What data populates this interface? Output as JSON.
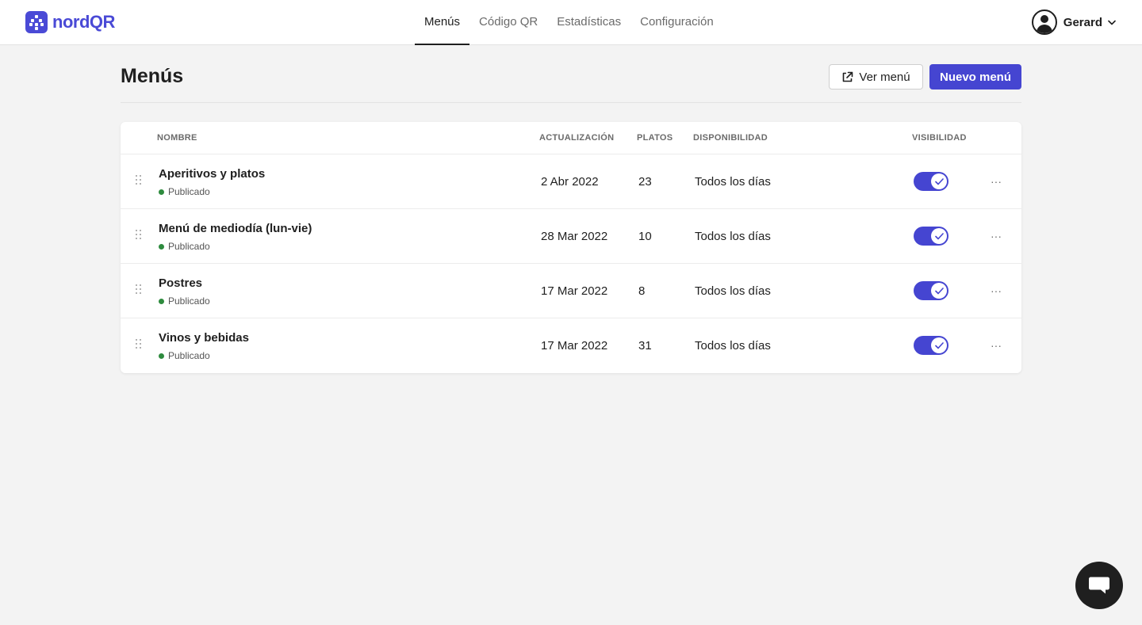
{
  "brand": {
    "name": "nordQR",
    "color": "#4a4ad6"
  },
  "nav": [
    {
      "label": "Menús",
      "active": true
    },
    {
      "label": "Código QR",
      "active": false
    },
    {
      "label": "Estadísticas",
      "active": false
    },
    {
      "label": "Configuración",
      "active": false
    }
  ],
  "user": {
    "name": "Gerard",
    "avatar_icon": "user-avatar-icon",
    "menu_icon": "chevron-down-icon"
  },
  "page": {
    "title": "Menús",
    "view_button": "Ver menú",
    "view_button_icon": "external-link-icon",
    "new_button": "Nuevo menú",
    "accent": "#4545d1"
  },
  "table": {
    "columns": {
      "name": "NOMBRE",
      "updated": "ACTUALIZACIÓN",
      "dishes": "PLATOS",
      "availability": "DISPONIBILIDAD",
      "visibility": "VISIBILIDAD"
    },
    "rows": [
      {
        "name": "Aperitivos y platos",
        "status": "Publicado",
        "updated": "2 Abr 2022",
        "dishes": "23",
        "availability": "Todos los días",
        "visible": true
      },
      {
        "name": "Menú de mediodía (lun-vie)",
        "status": "Publicado",
        "updated": "28 Mar 2022",
        "dishes": "10",
        "availability": "Todos los días",
        "visible": true
      },
      {
        "name": "Postres",
        "status": "Publicado",
        "updated": "17 Mar 2022",
        "dishes": "8",
        "availability": "Todos los días",
        "visible": true
      },
      {
        "name": "Vinos y bebidas",
        "status": "Publicado",
        "updated": "17 Mar 2022",
        "dishes": "31",
        "availability": "Todos los días",
        "visible": true
      }
    ],
    "status_color": "#2e8b3e",
    "more_label": "···"
  },
  "chat": {
    "icon": "chat-bubble-icon"
  }
}
